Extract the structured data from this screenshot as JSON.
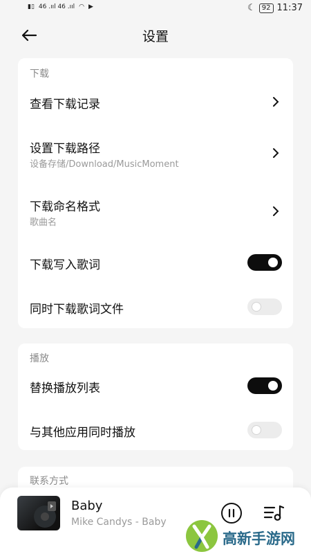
{
  "status": {
    "left_text": "46 .ııl 46 .ııl",
    "battery": "92",
    "time": "11:37"
  },
  "header": {
    "title": "设置"
  },
  "download": {
    "section": "下载",
    "view_records": "查看下载记录",
    "path_label": "设置下载路径",
    "path_value": "设备存储/Download/MusicMoment",
    "naming_label": "下载命名格式",
    "naming_value": "歌曲名",
    "write_lyrics": "下载写入歌词",
    "write_lyrics_on": true,
    "lyrics_file": "同时下载歌词文件",
    "lyrics_file_on": false
  },
  "playback": {
    "section": "播放",
    "replace_list": "替换播放列表",
    "replace_list_on": true,
    "mix_play": "与其他应用同时播放",
    "mix_play_on": false
  },
  "contact": {
    "section": "联系方式"
  },
  "player": {
    "song": "Baby",
    "artist": "Mike Candys - Baby"
  },
  "watermark": {
    "text": "高新手游网"
  },
  "colors": {
    "toggle_on": "#0d0d0d",
    "toggle_off": "#ececec",
    "background": "#f5f5f5"
  }
}
